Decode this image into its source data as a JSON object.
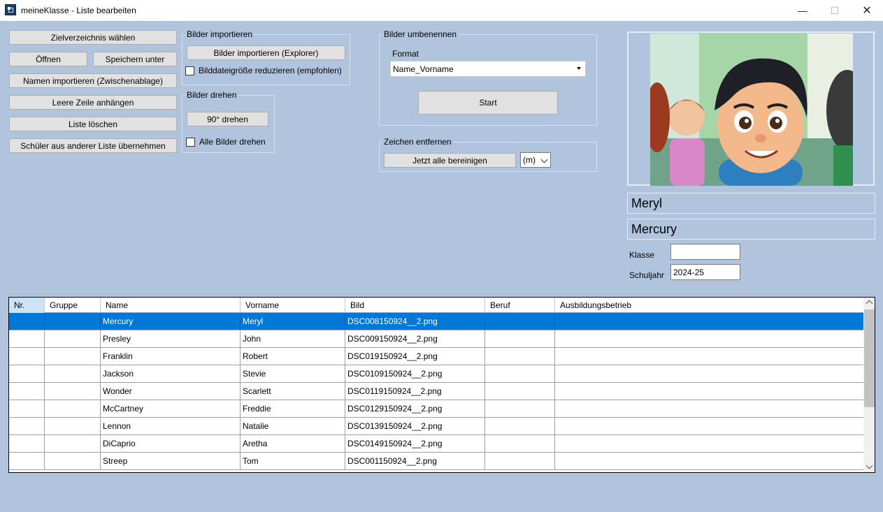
{
  "window": {
    "title": "meineKlasse - Liste bearbeiten",
    "minimize": "—",
    "maximize": "☐",
    "close": "✕"
  },
  "left_buttons": {
    "zielverzeichnis": "Zielverzeichnis wählen",
    "oeffnen": "Öffnen",
    "speichern_unter": "Speichern unter",
    "namen_importieren": "Namen importieren (Zwischenablage)",
    "leere_zeile": "Leere Zeile anhängen",
    "liste_loeschen": "Liste löschen",
    "schueler_uebernehmen": "Schüler aus anderer Liste übernehmen"
  },
  "bilder_importieren": {
    "label": "Bilder importieren",
    "button": "Bilder importieren (Explorer)",
    "checkbox_label": "Bilddateigröße reduzieren (empfohlen)",
    "checkbox_checked": false
  },
  "bilder_drehen": {
    "label": "Bilder drehen",
    "button": "90° drehen",
    "checkbox_label": "Alle Bilder drehen",
    "checkbox_checked": false
  },
  "bilder_umbenennen": {
    "label": "Bilder umbenennen",
    "format_label": "Format",
    "format_value": "Name_Vorname",
    "start_button": "Start"
  },
  "zeichen_entfernen": {
    "label": "Zeichen entfernen",
    "button": "Jetzt alle bereinigen",
    "select_value": "(m)"
  },
  "detail": {
    "vorname": "Meryl",
    "name": "Mercury",
    "klasse_label": "Klasse",
    "klasse_value": "",
    "schuljahr_label": "Schuljahr",
    "schuljahr_value": "2024-25"
  },
  "table": {
    "columns": [
      "Nr.",
      "Gruppe",
      "Name",
      "Vorname",
      "Bild",
      "Beruf",
      "Ausbildungsbetrieb"
    ],
    "selected_row": 0,
    "rows": [
      {
        "nr": "",
        "gruppe": "",
        "name": "Mercury",
        "vorname": "Meryl",
        "bild": "DSC008150924__2.png",
        "beruf": "",
        "betrieb": ""
      },
      {
        "nr": "",
        "gruppe": "",
        "name": "Presley",
        "vorname": "John",
        "bild": "DSC009150924__2.png",
        "beruf": "",
        "betrieb": ""
      },
      {
        "nr": "",
        "gruppe": "",
        "name": "Franklin",
        "vorname": "Robert",
        "bild": "DSC019150924__2.png",
        "beruf": "",
        "betrieb": ""
      },
      {
        "nr": "",
        "gruppe": "",
        "name": "Jackson",
        "vorname": "Stevie",
        "bild": "DSC0109150924__2.png",
        "beruf": "",
        "betrieb": ""
      },
      {
        "nr": "",
        "gruppe": "",
        "name": "Wonder",
        "vorname": "Scarlett",
        "bild": "DSC0119150924__2.png",
        "beruf": "",
        "betrieb": ""
      },
      {
        "nr": "",
        "gruppe": "",
        "name": "McCartney",
        "vorname": "Freddie",
        "bild": "DSC0129150924__2.png",
        "beruf": "",
        "betrieb": ""
      },
      {
        "nr": "",
        "gruppe": "",
        "name": "Lennon",
        "vorname": "Natalie",
        "bild": "DSC0139150924__2.png",
        "beruf": "",
        "betrieb": ""
      },
      {
        "nr": "",
        "gruppe": "",
        "name": "DiCaprio",
        "vorname": "Aretha",
        "bild": "DSC0149150924__2.png",
        "beruf": "",
        "betrieb": ""
      },
      {
        "nr": "",
        "gruppe": "",
        "name": "Streep",
        "vorname": "Tom",
        "bild": "DSC001150924__2.png",
        "beruf": "",
        "betrieb": ""
      }
    ]
  }
}
